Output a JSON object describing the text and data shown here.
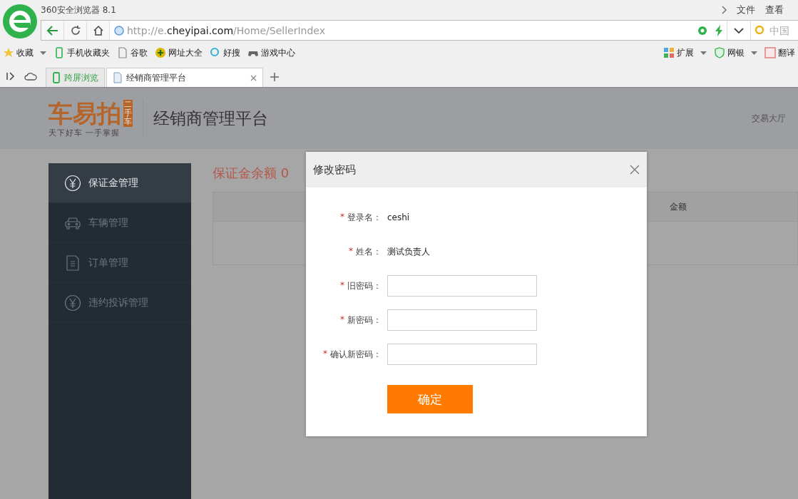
{
  "window": {
    "title": "360安全浏览器 8.1",
    "menu": [
      "文件",
      "查看"
    ]
  },
  "address_bar": {
    "url_prefix": "http://e.",
    "url_domain": "cheyipai.com",
    "url_path": "/Home/SellerIndex",
    "search_placeholder": "中国"
  },
  "bookmarks": [
    {
      "label": "收藏",
      "dropdown": true
    },
    {
      "label": "手机收藏夹",
      "dropdown": false
    },
    {
      "label": "谷歌",
      "dropdown": false
    },
    {
      "label": "网址大全",
      "dropdown": false
    },
    {
      "label": "好搜",
      "dropdown": false
    },
    {
      "label": "游戏中心",
      "dropdown": false
    }
  ],
  "tools": [
    {
      "label": "扩展",
      "dropdown": true
    },
    {
      "label": "网银",
      "dropdown": true
    },
    {
      "label": "翻译",
      "dropdown": false
    }
  ],
  "tabs": [
    {
      "label": "跨屏浏览",
      "kind": "phone",
      "selected": false
    },
    {
      "label": "经销商管理平台",
      "kind": "page",
      "selected": true
    }
  ],
  "header": {
    "logo": "车易拍",
    "logo_badge": "二手车",
    "logo_tagline": "天下好车 一手掌握",
    "title": "经销商管理平台",
    "link": "交易大厅"
  },
  "sidebar": {
    "items": [
      {
        "label": "保证金管理",
        "selected": true
      },
      {
        "label": "车辆管理",
        "selected": false
      },
      {
        "label": "订单管理",
        "selected": false
      },
      {
        "label": "违约投诉管理",
        "selected": false
      }
    ]
  },
  "balance": "保证金余额 0",
  "table": {
    "columns": [
      "金额"
    ]
  },
  "dialog": {
    "title": "修改密码",
    "fields": [
      {
        "label": "登录名：",
        "kind": "text",
        "value": "ceshi"
      },
      {
        "label": "姓名：",
        "kind": "text",
        "value": "测试负责人"
      },
      {
        "label": "旧密码：",
        "kind": "input"
      },
      {
        "label": "新密码：",
        "kind": "input"
      },
      {
        "label": "确认新密码：",
        "kind": "input"
      }
    ],
    "required_mark": "*",
    "submit": "确定"
  }
}
